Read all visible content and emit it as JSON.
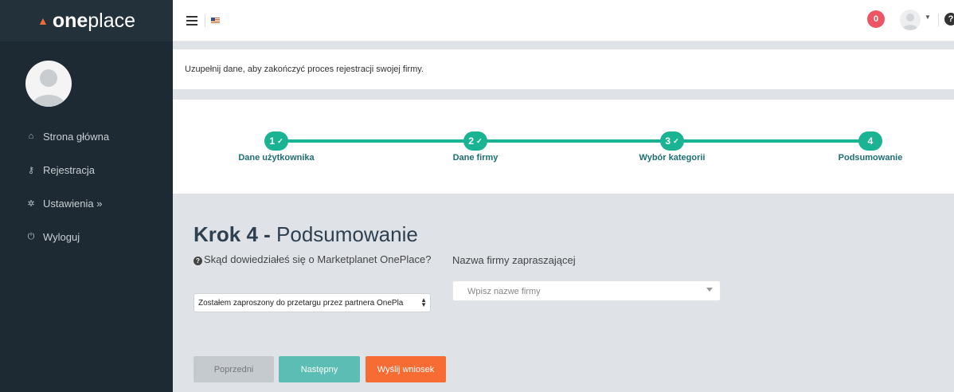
{
  "brand": {
    "mark": "▲",
    "name_bold": "one",
    "name_light": "place"
  },
  "sidebar": {
    "items": [
      {
        "icon": "home-icon",
        "glyph": "⌂",
        "label": "Strona główna"
      },
      {
        "icon": "key-icon",
        "glyph": "⚷",
        "label": "Rejestracja"
      },
      {
        "icon": "gear-icon",
        "glyph": "✲",
        "label": "Ustawienia »"
      },
      {
        "icon": "power-icon",
        "glyph": "⏻",
        "label": "Wyloguj"
      }
    ]
  },
  "topbar": {
    "notifications_count": "0",
    "help_glyph": "?"
  },
  "notice": "Uzupełnij dane, aby zakończyć proces rejestracji swojej firmy.",
  "wizard": {
    "steps": [
      {
        "number": "1",
        "done": true,
        "label": "Dane użytkownika"
      },
      {
        "number": "2",
        "done": true,
        "label": "Dane firmy"
      },
      {
        "number": "3",
        "done": true,
        "label": "Wybór kategorii"
      },
      {
        "number": "4",
        "done": false,
        "label": "Podsumowanie"
      }
    ],
    "check_glyph": "✓"
  },
  "form": {
    "heading_bold": "Krok 4 -",
    "heading_light": "Podsumowanie",
    "source_question": "Skąd dowiedziałeś się o Marketplanet OnePlace?",
    "source_value": "Zostałem zaproszony do przetargu przez partnera OnePla",
    "inviting_label": "Nazwa firmy zapraszającej",
    "inviting_placeholder": "Wpisz nazwe firmy"
  },
  "buttons": {
    "prev": "Poprzedni",
    "next": "Następny",
    "send": "Wyślij wniosek"
  },
  "colors": {
    "sidebar": "#1d2a33",
    "accent": "#1ab394",
    "send": "#f66c33",
    "notif": "#ed5565"
  }
}
